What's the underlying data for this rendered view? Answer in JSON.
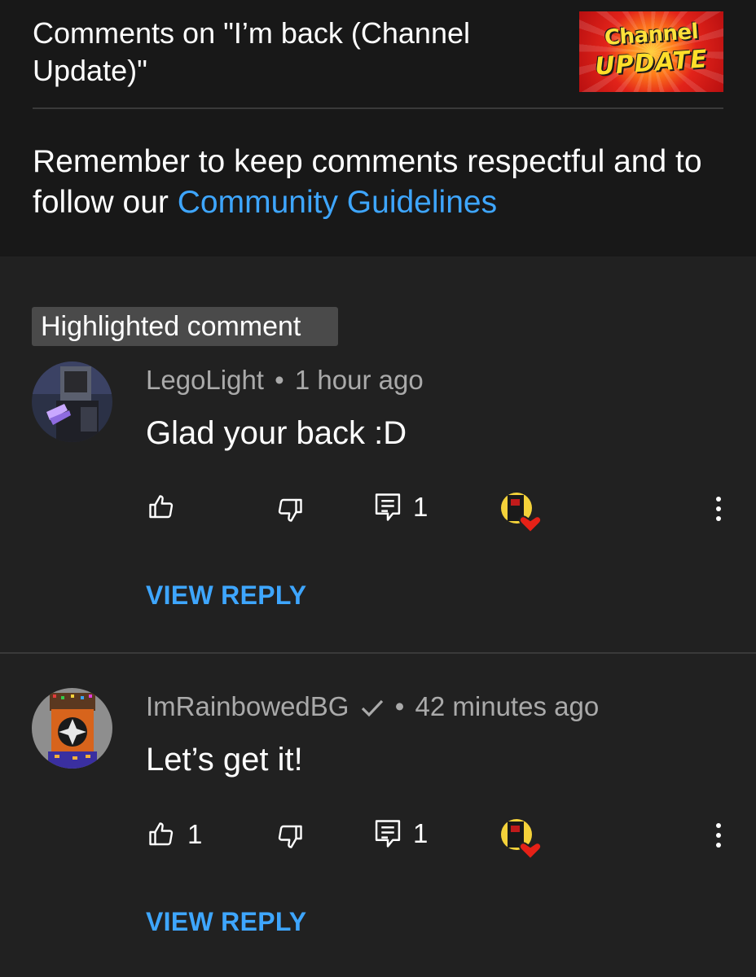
{
  "header": {
    "title": "Comments on \"I’m back (Channel Update)\"",
    "thumbnail": {
      "line1": "Channel",
      "line2": "UPDATE"
    }
  },
  "notice": {
    "text": "Remember to keep comments respectful and to follow our ",
    "link": "Community Guidelines"
  },
  "highlight_badge": "Highlighted comment",
  "comments": [
    {
      "author": "LegoLight",
      "separator": "•",
      "time": "1 hour ago",
      "verified": false,
      "text": "Glad your back :D",
      "likes": "",
      "replies": "1",
      "creator_hearted": true,
      "view_reply": "VIEW REPLY"
    },
    {
      "author": "ImRainbowedBG",
      "separator": "•",
      "time": "42 minutes ago",
      "verified": true,
      "text": "Let’s get it!",
      "likes": "1",
      "replies": "1",
      "creator_hearted": true,
      "view_reply": "VIEW REPLY"
    }
  ],
  "colors": {
    "background": "#212121",
    "header_background": "#181818",
    "link": "#3ea6ff",
    "meta_text": "#aaaaaa",
    "heart": "#e62117"
  },
  "icons": [
    "thumbs-up-icon",
    "thumbs-down-icon",
    "reply-icon",
    "heart-icon",
    "more-vert-icon",
    "verified-check-icon"
  ]
}
